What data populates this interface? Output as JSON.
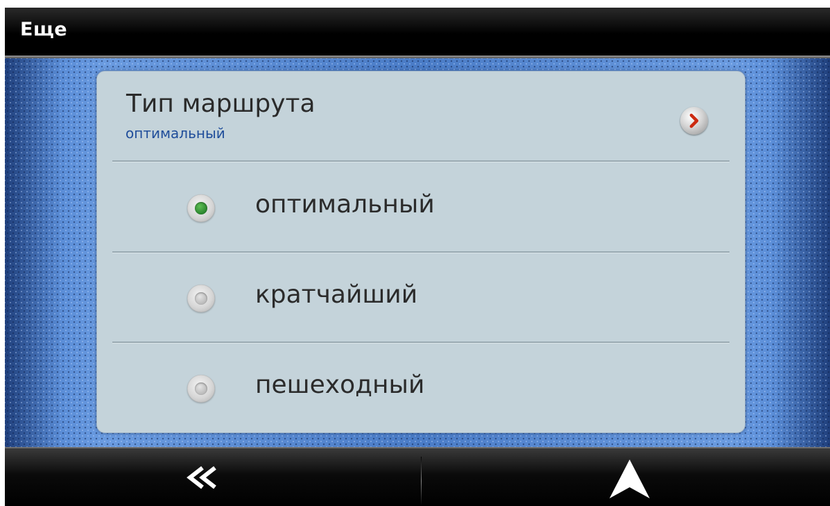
{
  "header": {
    "title": "Еще"
  },
  "route": {
    "title": "Тип маршрута",
    "current_value": "оптимальный",
    "options": [
      {
        "label": "оптимальный",
        "selected": true
      },
      {
        "label": "кратчайший",
        "selected": false
      },
      {
        "label": "пешеходный",
        "selected": false
      }
    ]
  },
  "icons": {
    "chevron": "chevron-right-icon",
    "back": "double-chevron-left-icon",
    "navigate": "navigation-arrow-icon"
  },
  "colors": {
    "selected_radio": "#1a7a22",
    "subtitle": "#1f4d9a",
    "chevron": "#cc2a10",
    "panel": "#c4d3da",
    "background": "#4a7cc7"
  }
}
